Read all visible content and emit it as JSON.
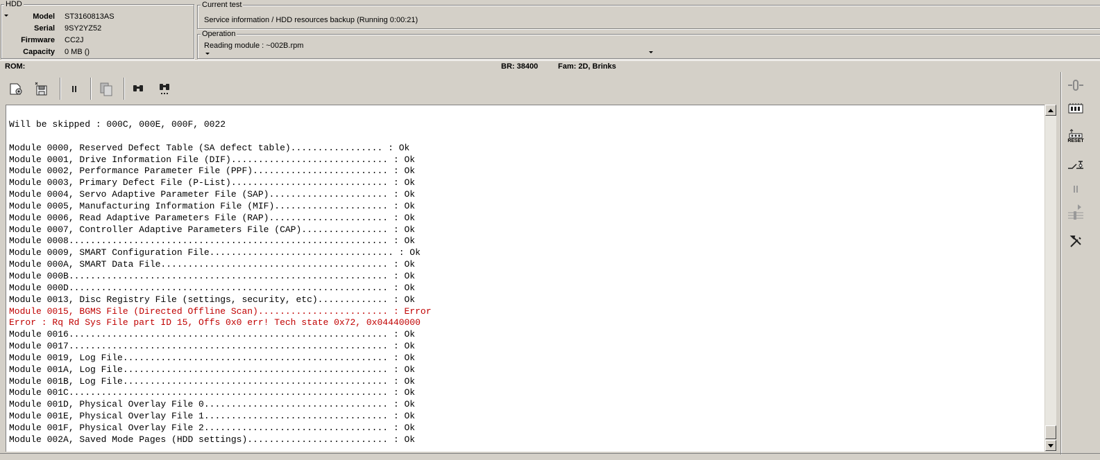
{
  "hdd": {
    "title": "HDD",
    "rows": [
      {
        "label": "Model",
        "value": "ST3160813AS"
      },
      {
        "label": "Serial",
        "value": "9SY2YZ52"
      },
      {
        "label": "Firmware",
        "value": "CC2J"
      },
      {
        "label": "Capacity",
        "value": "0 MB ()"
      }
    ]
  },
  "current_test": {
    "title": "Current test",
    "text": "Service information / HDD resources backup (Running 0:00:21)"
  },
  "operation": {
    "title": "Operation",
    "text": "Reading module : ~002B.rpm"
  },
  "status": {
    "rom": "ROM:",
    "br": "BR: 38400",
    "fam": "Fam: 2D, Brinks"
  },
  "toolbar": {
    "icons": [
      "module-settings-icon",
      "save-module-icon",
      "pause-icon",
      "copy-icon",
      "find-icon",
      "find-next-icon"
    ]
  },
  "right_panel": {
    "icons": [
      "power-icon",
      "interface-board-icon",
      "reset-icon",
      "relay-icon",
      "pause-icon",
      "step-icon",
      "tools-icon"
    ],
    "reset_label": "RESET"
  },
  "log": {
    "lines": [
      {
        "text": "Will be skipped : 000C, 000E, 000F, 0022",
        "error": false
      },
      {
        "text": "",
        "error": false
      },
      {
        "text": "Module 0000, Reserved Defect Table (SA defect table)................. : Ok",
        "error": false
      },
      {
        "text": "Module 0001, Drive Information File (DIF)............................. : Ok",
        "error": false
      },
      {
        "text": "Module 0002, Performance Parameter File (PPF)......................... : Ok",
        "error": false
      },
      {
        "text": "Module 0003, Primary Defect File (P-List)............................. : Ok",
        "error": false
      },
      {
        "text": "Module 0004, Servo Adaptive Parameter File (SAP)...................... : Ok",
        "error": false
      },
      {
        "text": "Module 0005, Manufacturing Information File (MIF)..................... : Ok",
        "error": false
      },
      {
        "text": "Module 0006, Read Adaptive Parameters File (RAP)...................... : Ok",
        "error": false
      },
      {
        "text": "Module 0007, Controller Adaptive Parameters File (CAP)................ : Ok",
        "error": false
      },
      {
        "text": "Module 0008........................................................... : Ok",
        "error": false
      },
      {
        "text": "Module 0009, SMART Configuration File.................................. : Ok",
        "error": false
      },
      {
        "text": "Module 000A, SMART Data File.......................................... : Ok",
        "error": false
      },
      {
        "text": "Module 000B........................................................... : Ok",
        "error": false
      },
      {
        "text": "Module 000D........................................................... : Ok",
        "error": false
      },
      {
        "text": "Module 0013, Disc Registry File (settings, security, etc)............. : Ok",
        "error": false
      },
      {
        "text": "Module 0015, BGMS File (Directed Offline Scan)........................ : Error",
        "error": true
      },
      {
        "text": "Error : Rq Rd Sys File part ID 15, Offs 0x0 err! Tech state 0x72, 0x04440000",
        "error": true
      },
      {
        "text": "Module 0016........................................................... : Ok",
        "error": false
      },
      {
        "text": "Module 0017........................................................... : Ok",
        "error": false
      },
      {
        "text": "Module 0019, Log File................................................. : Ok",
        "error": false
      },
      {
        "text": "Module 001A, Log File................................................. : Ok",
        "error": false
      },
      {
        "text": "Module 001B, Log File................................................. : Ok",
        "error": false
      },
      {
        "text": "Module 001C........................................................... : Ok",
        "error": false
      },
      {
        "text": "Module 001D, Physical Overlay File 0.................................. : Ok",
        "error": false
      },
      {
        "text": "Module 001E, Physical Overlay File 1.................................. : Ok",
        "error": false
      },
      {
        "text": "Module 001F, Physical Overlay File 2.................................. : Ok",
        "error": false
      },
      {
        "text": "Module 002A, Saved Mode Pages (HDD settings).......................... : Ok",
        "error": false
      }
    ]
  }
}
